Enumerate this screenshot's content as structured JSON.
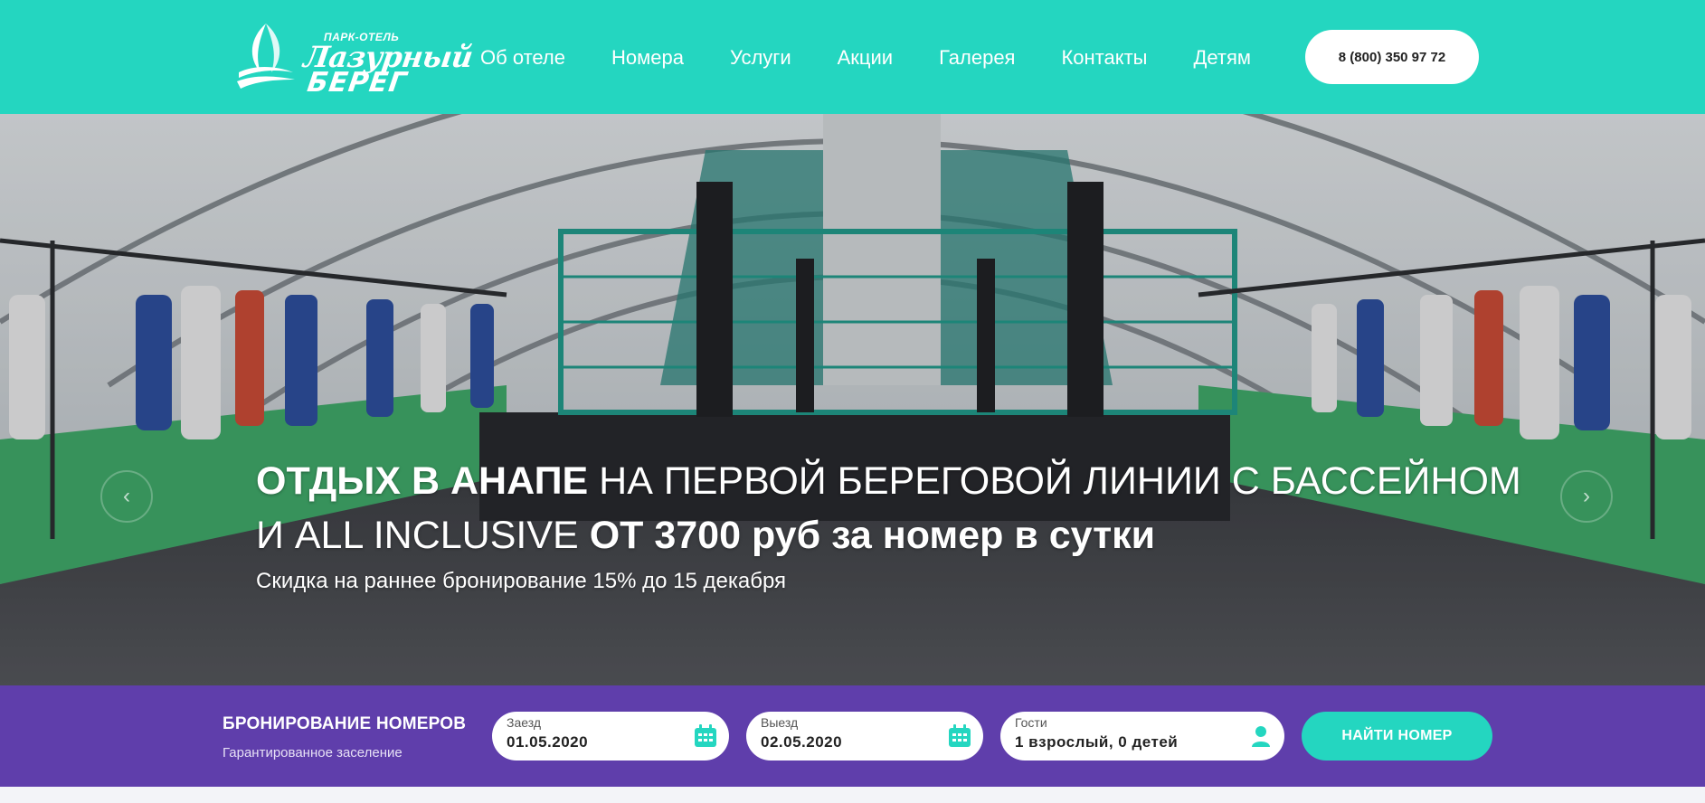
{
  "logo": {
    "line1": "ПАРК-ОТЕЛЬ",
    "line2": "Лазурный",
    "line3": "БЕРЕГ"
  },
  "nav": {
    "items": [
      {
        "label": "Об отеле"
      },
      {
        "label": "Номера"
      },
      {
        "label": "Услуги"
      },
      {
        "label": "Акции"
      },
      {
        "label": "Галерея"
      },
      {
        "label": "Контакты"
      },
      {
        "label": "Детям"
      }
    ]
  },
  "header": {
    "phone": "8 (800) 350 97 72"
  },
  "hero": {
    "title_bold_1": "ОТДЫХ В АНАПЕ",
    "title_regular": "НА ПЕРВОЙ БЕРЕГОВОЙ ЛИНИИ С БАССЕЙНОМ И ALL INCLUSIVE",
    "title_bold_2": "ОТ 3700 руб за номер в сутки",
    "subtitle": "Скидка на раннее бронирование 15% до 15 декабря",
    "prev_icon": "chevron-left-icon",
    "next_icon": "chevron-right-icon"
  },
  "booking": {
    "title": "БРОНИРОВАНИЕ НОМЕРОВ",
    "subtitle": "Гарантированное заселение",
    "checkin": {
      "label": "Заезд",
      "value": "01.05.2020",
      "icon": "calendar-icon"
    },
    "checkout": {
      "label": "Выезд",
      "value": "02.05.2020",
      "icon": "calendar-icon"
    },
    "guests": {
      "label": "Гости",
      "value": "1 взрослый, 0 детей",
      "icon": "user-icon"
    },
    "search_label": "НАЙТИ НОМЕР"
  },
  "colors": {
    "header_bg": "#24d6c0",
    "booking_bg": "#5f3eab",
    "accent": "#24d6c0"
  }
}
